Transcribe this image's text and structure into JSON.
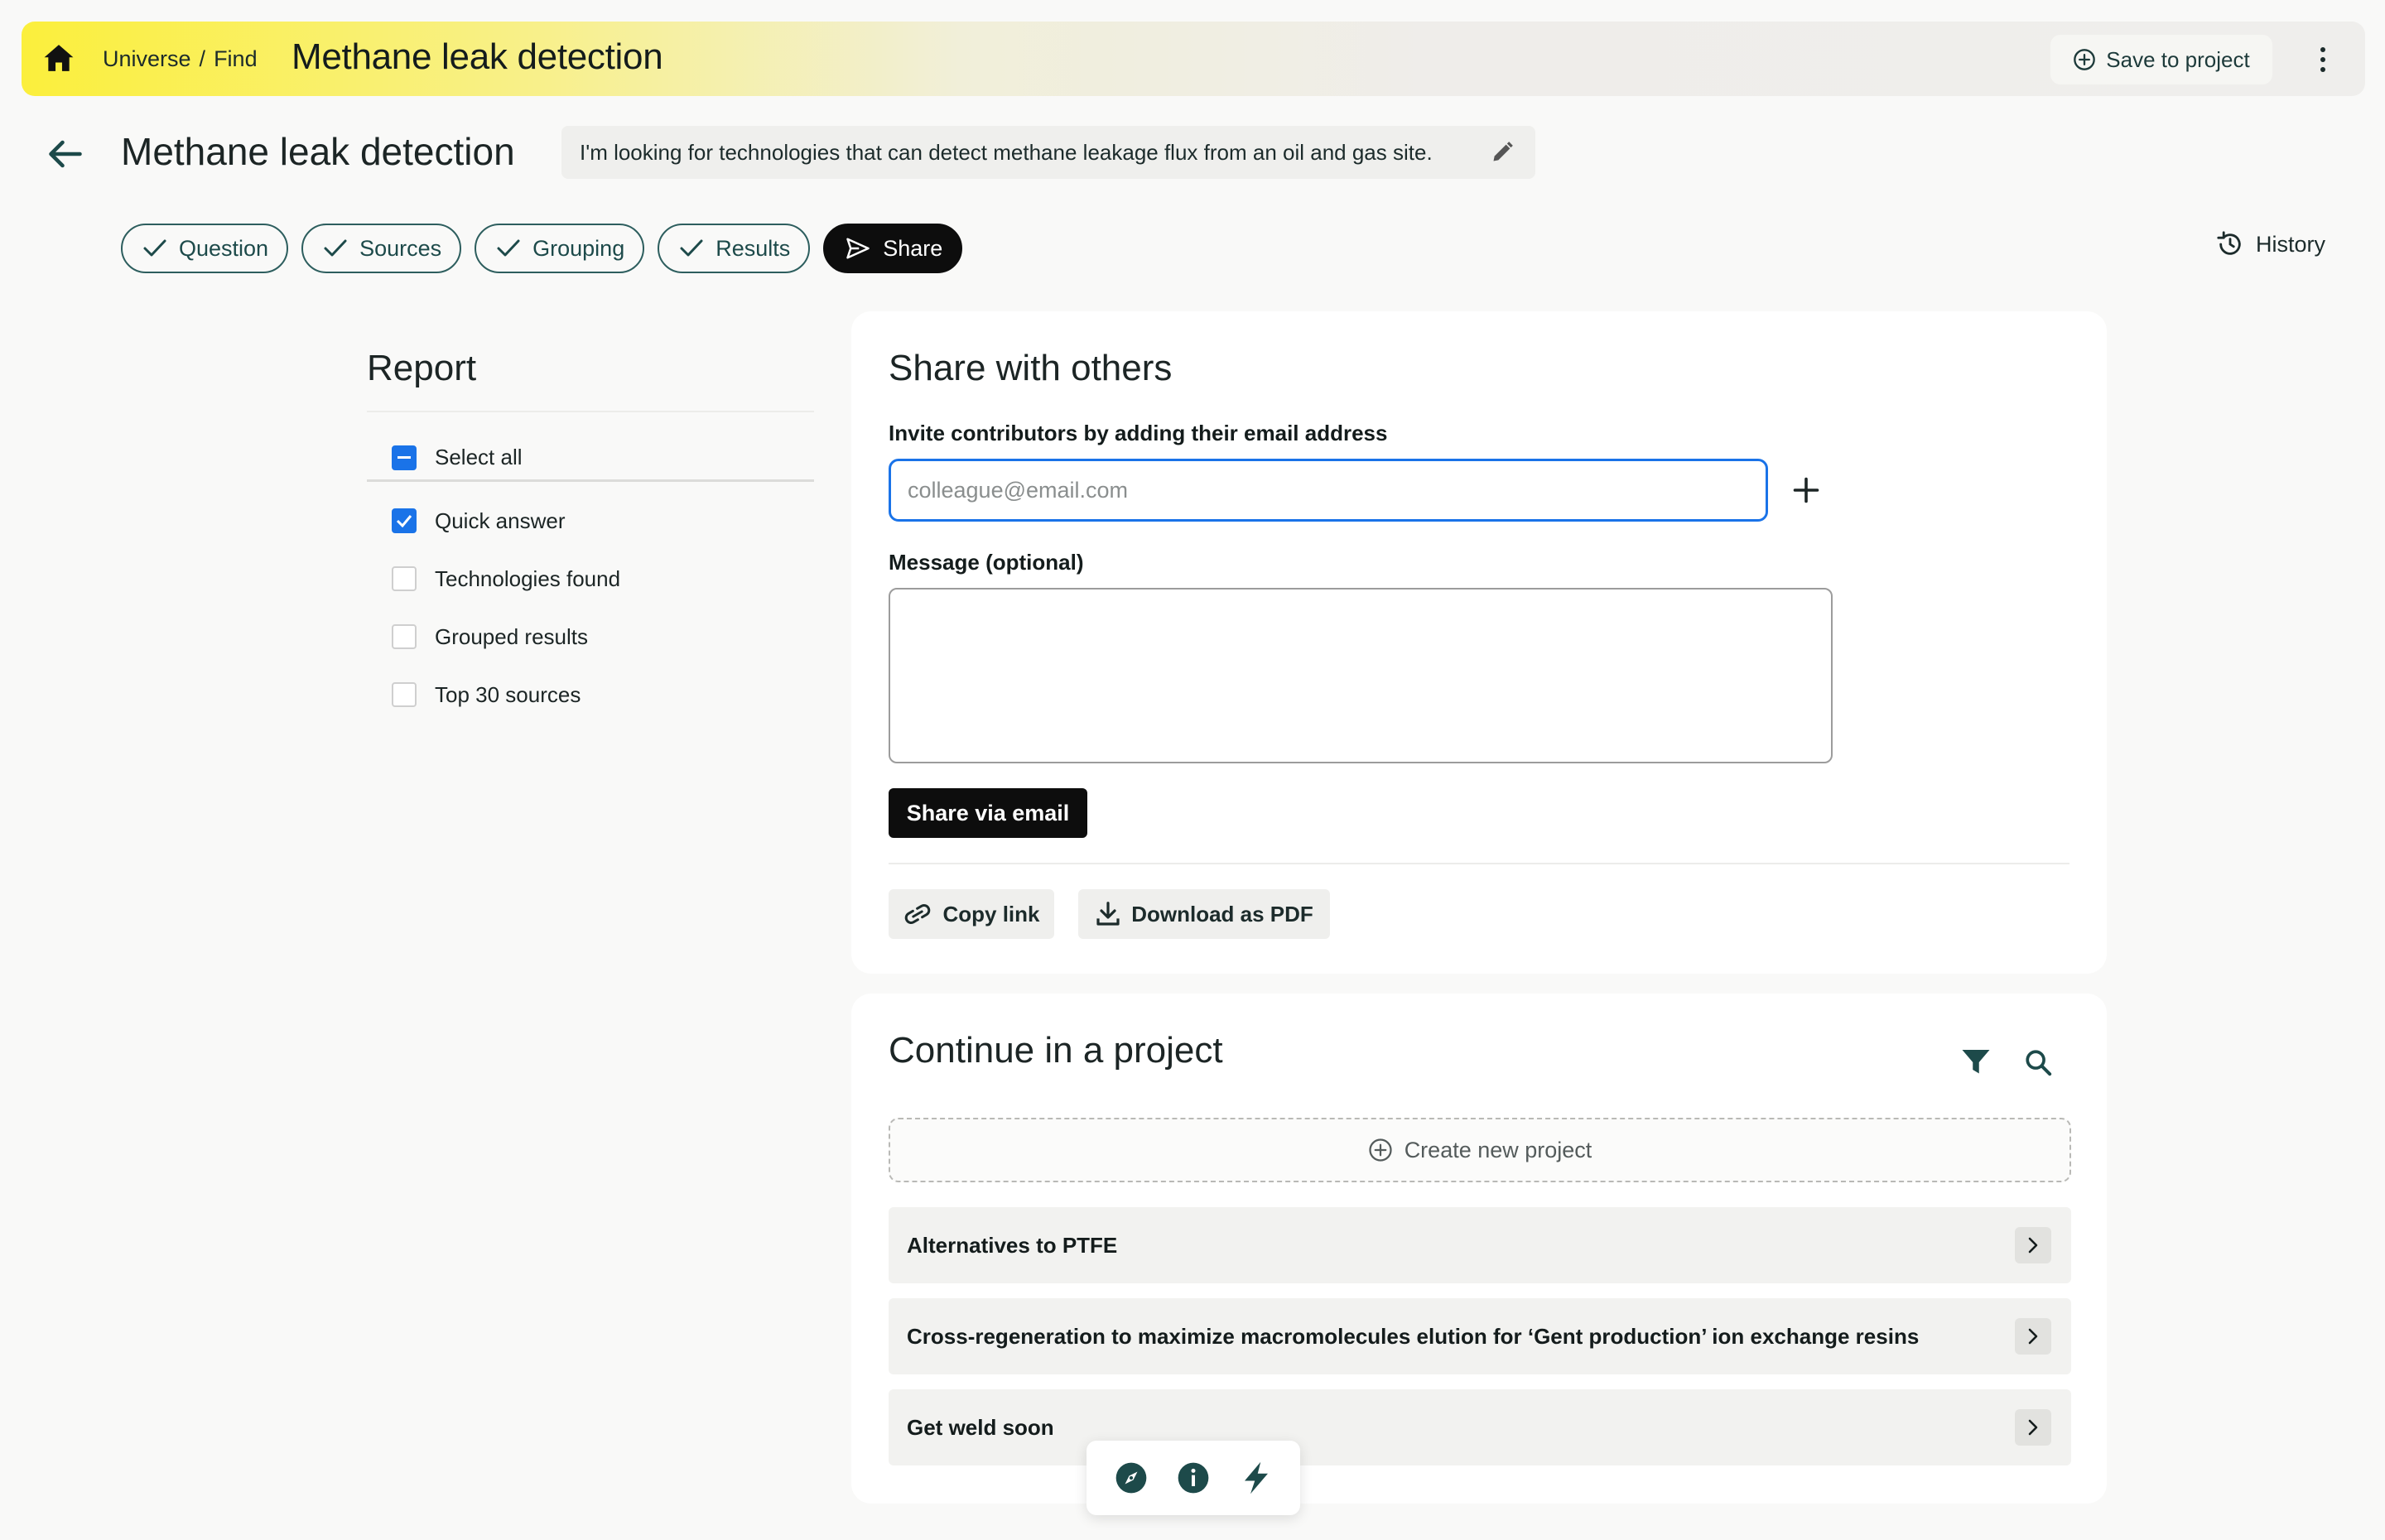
{
  "topbar": {
    "breadcrumb": [
      "Universe",
      "Find"
    ],
    "title": "Methane leak detection",
    "save_label": "Save to project"
  },
  "header": {
    "title": "Methane leak detection",
    "question": "I'm looking for technologies that can detect methane leakage flux from an oil and gas site."
  },
  "steps": [
    {
      "label": "Question",
      "done": true
    },
    {
      "label": "Sources",
      "done": true
    },
    {
      "label": "Grouping",
      "done": true
    },
    {
      "label": "Results",
      "done": true
    },
    {
      "label": "Share",
      "active": true
    }
  ],
  "history_label": "History",
  "report": {
    "title": "Report",
    "items": [
      {
        "label": "Select all",
        "state": "mixed"
      },
      {
        "label": "Quick answer",
        "state": "checked"
      },
      {
        "label": "Technologies found",
        "state": "unchecked"
      },
      {
        "label": "Grouped results",
        "state": "unchecked"
      },
      {
        "label": "Top 30 sources",
        "state": "unchecked"
      }
    ]
  },
  "share": {
    "title": "Share with others",
    "invite_label": "Invite contributors by adding their email address",
    "email_placeholder": "colleague@email.com",
    "message_label": "Message (optional)",
    "share_button": "Share via email",
    "copy_link": "Copy link",
    "download_pdf": "Download as PDF"
  },
  "continue": {
    "title": "Continue in a project",
    "create_new": "Create new project",
    "projects": [
      "Alternatives to PTFE",
      "Cross-regeneration to maximize macromolecules elution for ‘Gent production’ ion exchange resins",
      "Get weld soon"
    ]
  },
  "colors": {
    "accent_blue": "#1a73e8",
    "teal_dark": "#1d4a4a",
    "topbar_yellow": "#fbef3c"
  },
  "dock_icons": [
    "compass-icon",
    "info-icon",
    "lightning-icon"
  ]
}
